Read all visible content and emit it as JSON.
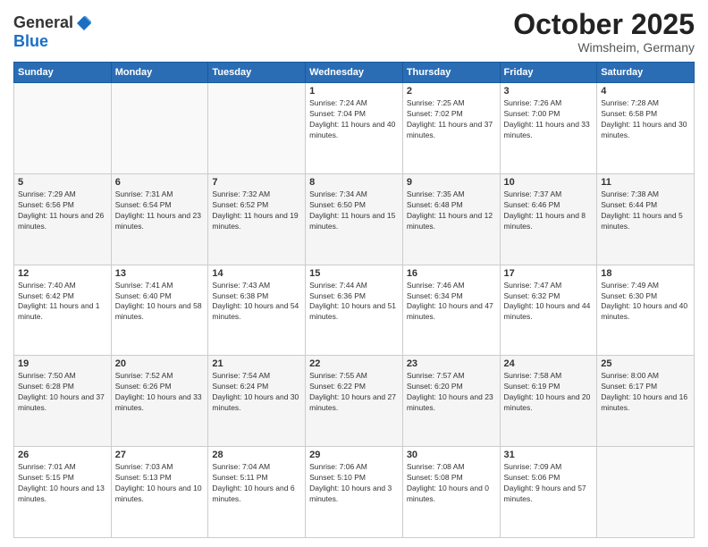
{
  "header": {
    "logo_general": "General",
    "logo_blue": "Blue",
    "month": "October 2025",
    "location": "Wimsheim, Germany"
  },
  "days_of_week": [
    "Sunday",
    "Monday",
    "Tuesday",
    "Wednesday",
    "Thursday",
    "Friday",
    "Saturday"
  ],
  "weeks": [
    [
      {
        "day": "",
        "info": ""
      },
      {
        "day": "",
        "info": ""
      },
      {
        "day": "",
        "info": ""
      },
      {
        "day": "1",
        "info": "Sunrise: 7:24 AM\nSunset: 7:04 PM\nDaylight: 11 hours and 40 minutes."
      },
      {
        "day": "2",
        "info": "Sunrise: 7:25 AM\nSunset: 7:02 PM\nDaylight: 11 hours and 37 minutes."
      },
      {
        "day": "3",
        "info": "Sunrise: 7:26 AM\nSunset: 7:00 PM\nDaylight: 11 hours and 33 minutes."
      },
      {
        "day": "4",
        "info": "Sunrise: 7:28 AM\nSunset: 6:58 PM\nDaylight: 11 hours and 30 minutes."
      }
    ],
    [
      {
        "day": "5",
        "info": "Sunrise: 7:29 AM\nSunset: 6:56 PM\nDaylight: 11 hours and 26 minutes."
      },
      {
        "day": "6",
        "info": "Sunrise: 7:31 AM\nSunset: 6:54 PM\nDaylight: 11 hours and 23 minutes."
      },
      {
        "day": "7",
        "info": "Sunrise: 7:32 AM\nSunset: 6:52 PM\nDaylight: 11 hours and 19 minutes."
      },
      {
        "day": "8",
        "info": "Sunrise: 7:34 AM\nSunset: 6:50 PM\nDaylight: 11 hours and 15 minutes."
      },
      {
        "day": "9",
        "info": "Sunrise: 7:35 AM\nSunset: 6:48 PM\nDaylight: 11 hours and 12 minutes."
      },
      {
        "day": "10",
        "info": "Sunrise: 7:37 AM\nSunset: 6:46 PM\nDaylight: 11 hours and 8 minutes."
      },
      {
        "day": "11",
        "info": "Sunrise: 7:38 AM\nSunset: 6:44 PM\nDaylight: 11 hours and 5 minutes."
      }
    ],
    [
      {
        "day": "12",
        "info": "Sunrise: 7:40 AM\nSunset: 6:42 PM\nDaylight: 11 hours and 1 minute."
      },
      {
        "day": "13",
        "info": "Sunrise: 7:41 AM\nSunset: 6:40 PM\nDaylight: 10 hours and 58 minutes."
      },
      {
        "day": "14",
        "info": "Sunrise: 7:43 AM\nSunset: 6:38 PM\nDaylight: 10 hours and 54 minutes."
      },
      {
        "day": "15",
        "info": "Sunrise: 7:44 AM\nSunset: 6:36 PM\nDaylight: 10 hours and 51 minutes."
      },
      {
        "day": "16",
        "info": "Sunrise: 7:46 AM\nSunset: 6:34 PM\nDaylight: 10 hours and 47 minutes."
      },
      {
        "day": "17",
        "info": "Sunrise: 7:47 AM\nSunset: 6:32 PM\nDaylight: 10 hours and 44 minutes."
      },
      {
        "day": "18",
        "info": "Sunrise: 7:49 AM\nSunset: 6:30 PM\nDaylight: 10 hours and 40 minutes."
      }
    ],
    [
      {
        "day": "19",
        "info": "Sunrise: 7:50 AM\nSunset: 6:28 PM\nDaylight: 10 hours and 37 minutes."
      },
      {
        "day": "20",
        "info": "Sunrise: 7:52 AM\nSunset: 6:26 PM\nDaylight: 10 hours and 33 minutes."
      },
      {
        "day": "21",
        "info": "Sunrise: 7:54 AM\nSunset: 6:24 PM\nDaylight: 10 hours and 30 minutes."
      },
      {
        "day": "22",
        "info": "Sunrise: 7:55 AM\nSunset: 6:22 PM\nDaylight: 10 hours and 27 minutes."
      },
      {
        "day": "23",
        "info": "Sunrise: 7:57 AM\nSunset: 6:20 PM\nDaylight: 10 hours and 23 minutes."
      },
      {
        "day": "24",
        "info": "Sunrise: 7:58 AM\nSunset: 6:19 PM\nDaylight: 10 hours and 20 minutes."
      },
      {
        "day": "25",
        "info": "Sunrise: 8:00 AM\nSunset: 6:17 PM\nDaylight: 10 hours and 16 minutes."
      }
    ],
    [
      {
        "day": "26",
        "info": "Sunrise: 7:01 AM\nSunset: 5:15 PM\nDaylight: 10 hours and 13 minutes."
      },
      {
        "day": "27",
        "info": "Sunrise: 7:03 AM\nSunset: 5:13 PM\nDaylight: 10 hours and 10 minutes."
      },
      {
        "day": "28",
        "info": "Sunrise: 7:04 AM\nSunset: 5:11 PM\nDaylight: 10 hours and 6 minutes."
      },
      {
        "day": "29",
        "info": "Sunrise: 7:06 AM\nSunset: 5:10 PM\nDaylight: 10 hours and 3 minutes."
      },
      {
        "day": "30",
        "info": "Sunrise: 7:08 AM\nSunset: 5:08 PM\nDaylight: 10 hours and 0 minutes."
      },
      {
        "day": "31",
        "info": "Sunrise: 7:09 AM\nSunset: 5:06 PM\nDaylight: 9 hours and 57 minutes."
      },
      {
        "day": "",
        "info": ""
      }
    ]
  ]
}
